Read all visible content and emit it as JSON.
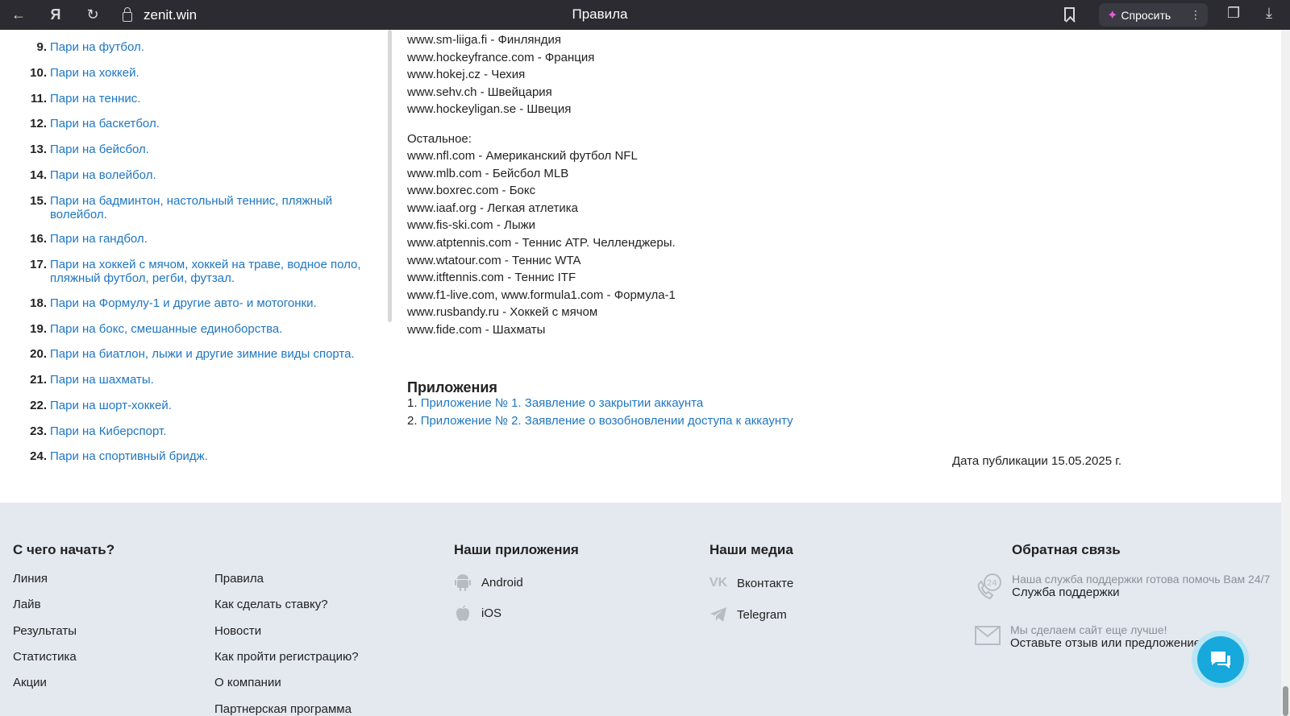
{
  "browser": {
    "url": "zenit.win",
    "title": "Правила",
    "ask_label": "Спросить"
  },
  "toc": [
    {
      "num": "9.",
      "label": "Пари на футбол."
    },
    {
      "num": "10.",
      "label": "Пари на хоккей."
    },
    {
      "num": "11.",
      "label": "Пари на теннис."
    },
    {
      "num": "12.",
      "label": "Пари на баскетбол."
    },
    {
      "num": "13.",
      "label": "Пари на бейсбол."
    },
    {
      "num": "14.",
      "label": "Пари на волейбол."
    },
    {
      "num": "15.",
      "label": "Пари на бадминтон, настольный теннис, пляжный волейбол."
    },
    {
      "num": "16.",
      "label": "Пари на гандбол."
    },
    {
      "num": "17.",
      "label": "Пари на хоккей с мячом, хоккей на траве, водное поло, пляжный футбол, регби, футзал."
    },
    {
      "num": "18.",
      "label": "Пари на Формулу-1 и другие авто- и мотогонки."
    },
    {
      "num": "19.",
      "label": "Пари на бокс, смешанные единоборства."
    },
    {
      "num": "20.",
      "label": "Пари на биатлон, лыжи и другие зимние виды спорта."
    },
    {
      "num": "21.",
      "label": "Пари на шахматы."
    },
    {
      "num": "22.",
      "label": "Пари на шорт-хоккей."
    },
    {
      "num": "23.",
      "label": "Пари на Киберспорт."
    },
    {
      "num": "24.",
      "label": "Пари на спортивный бридж."
    }
  ],
  "content": {
    "hockey_sites": [
      "www.sm-liiga.fi - Финляндия",
      "www.hockeyfrance.com - Франция",
      "www.hokej.cz - Чехия",
      "www.sehv.ch - Швейцария",
      "www.hockeyligan.se - Швеция"
    ],
    "other_title": "Остальное:",
    "other_sites": [
      "www.nfl.com - Американский футбол NFL",
      "www.mlb.com - Бейсбол MLB",
      "www.boxrec.com - Бокс",
      "www.iaaf.org - Легкая атлетика",
      "www.fis-ski.com - Лыжи",
      "www.atptennis.com - Теннис ATP. Челленджеры.",
      "www.wtatour.com - Теннис WTA",
      "www.itftennis.com - Теннис ITF",
      "www.f1-live.com, www.formula1.com - Формула-1",
      "www.rusbandy.ru - Хоккей с мячом",
      "www.fide.com - Шахматы"
    ],
    "appendix_title": "Приложения",
    "appendices": [
      {
        "num": "1.",
        "label": "Приложение № 1. Заявление о закрытии аккаунта"
      },
      {
        "num": "2.",
        "label": "Приложение № 2. Заявление о возобновлении доступа к аккаунту"
      }
    ],
    "pub_date": "Дата публикации 15.05.2025 г."
  },
  "footer": {
    "start_title": "С чего начать?",
    "start_col1": [
      "Линия",
      "Лайв",
      "Результаты",
      "Статистика",
      "Акции"
    ],
    "start_col2": [
      "Правила",
      "Как сделать ставку?",
      "Новости",
      "Как пройти регистрацию?",
      "О компании",
      "Партнерская программа"
    ],
    "apps_title": "Наши приложения",
    "apps": [
      {
        "icon": "android-icon",
        "label": "Android"
      },
      {
        "icon": "apple-icon",
        "label": "iOS"
      }
    ],
    "media_title": "Наши медиа",
    "media": [
      {
        "icon": "vk-icon",
        "label": "Вконтакте"
      },
      {
        "icon": "telegram-icon",
        "label": "Telegram"
      }
    ],
    "feedback_title": "Обратная связь",
    "support_small": "Наша служба поддержки готова помочь Вам 24/7",
    "support_big": "Служба поддержки",
    "review_small": "Мы сделаем сайт еще лучше!",
    "review_big": "Оставьте отзыв или предложение"
  }
}
